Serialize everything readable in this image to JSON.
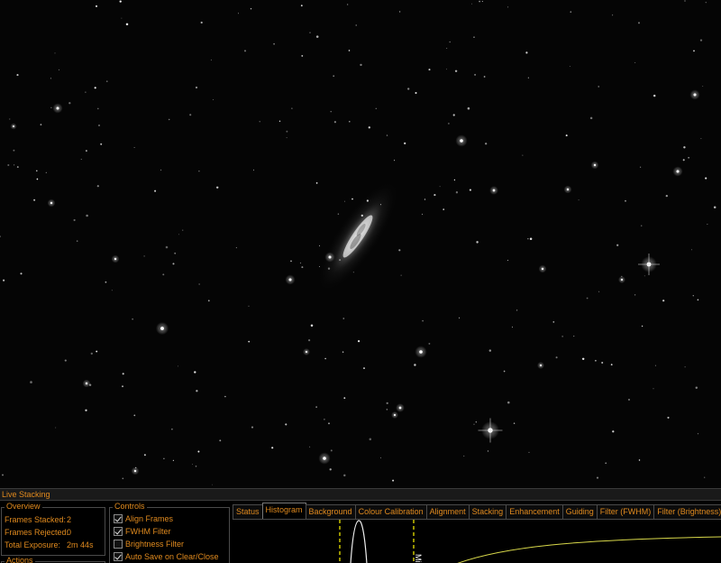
{
  "panel": {
    "title": "Live Stacking"
  },
  "overview": {
    "label": "Overview",
    "frames_stacked_label": "Frames Stacked:",
    "frames_stacked": "2",
    "frames_rejected_label": "Frames Rejected:",
    "frames_rejected": "0",
    "total_exposure_label": "Total Exposure:",
    "total_exposure": "2m 44s"
  },
  "actions": {
    "label": "Actions"
  },
  "controls": {
    "label": "Controls",
    "items": [
      {
        "label": "Align Frames",
        "checked": true
      },
      {
        "label": "FWHM Filter",
        "checked": true
      },
      {
        "label": "Brightness Filter",
        "checked": false
      },
      {
        "label": "Auto Save on Clear/Close",
        "checked": true
      }
    ]
  },
  "tabs": [
    {
      "label": "Status",
      "active": false
    },
    {
      "label": "Histogram",
      "active": true
    },
    {
      "label": "Background",
      "active": false
    },
    {
      "label": "Colour Calibration",
      "active": false
    },
    {
      "label": "Alignment",
      "active": false
    },
    {
      "label": "Stacking",
      "active": false
    },
    {
      "label": "Enhancement",
      "active": false
    },
    {
      "label": "Guiding",
      "active": false
    },
    {
      "label": "Filter (FWHM)",
      "active": false
    },
    {
      "label": "Filter (Brightness)",
      "active": false
    }
  ],
  "histogram": {
    "marker_label": "Mi"
  },
  "colors": {
    "accent": "#e08a1e",
    "marker": "#e8e000",
    "curve": "#d8d84a"
  }
}
